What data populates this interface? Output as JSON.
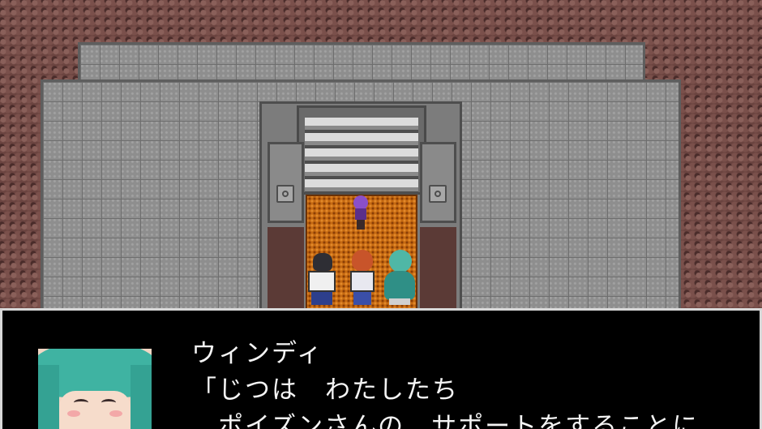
{
  "dialogue": {
    "speaker": "ウィンディ",
    "lines": [
      "「じつは　わたしたち",
      "　ポイズンさんの　サポートをすることに"
    ]
  },
  "colors": {
    "rock": "#6b4440",
    "floor": "#8e8e8e",
    "carpet": "#c66a12",
    "message_window_bg": "#000000",
    "message_window_border": "#d8d8d8",
    "text": "#f4f4f4"
  }
}
